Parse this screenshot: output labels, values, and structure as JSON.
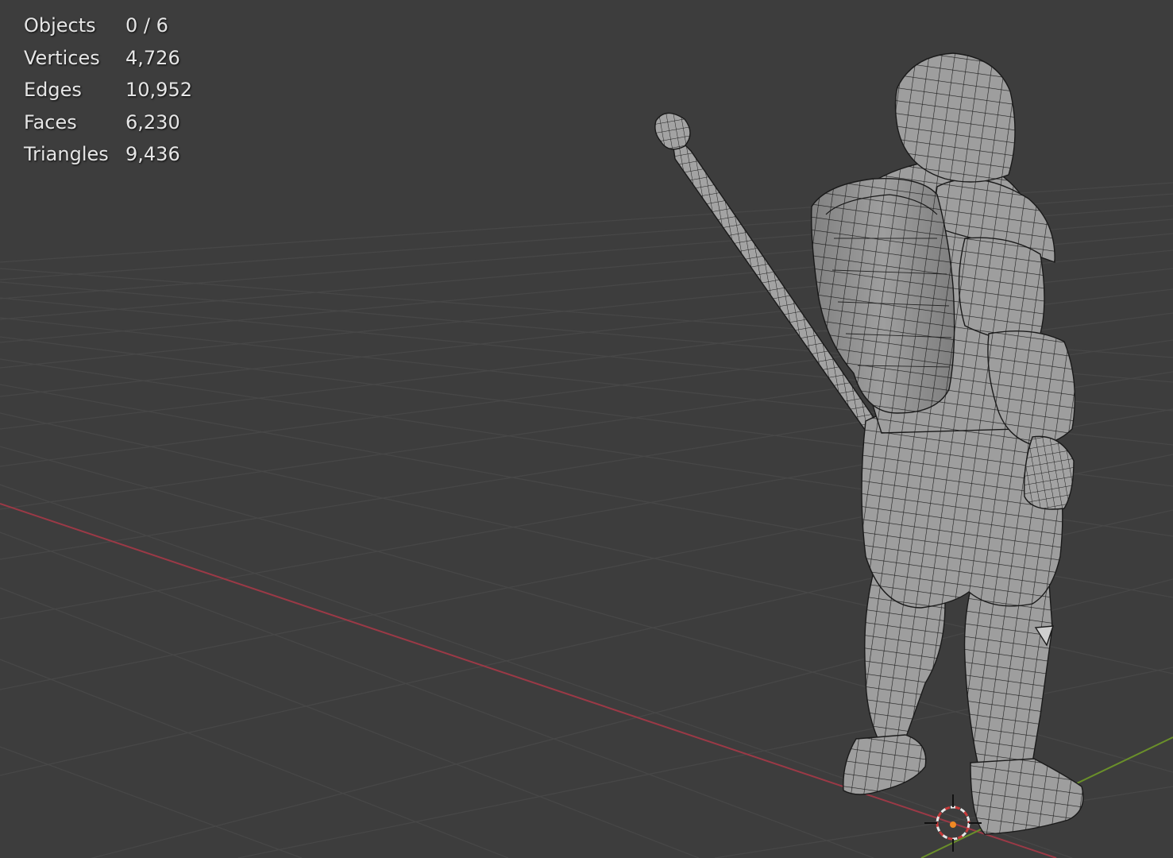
{
  "stats": {
    "rows": [
      {
        "label": "Objects",
        "value": "0 / 6"
      },
      {
        "label": "Vertices",
        "value": "4,726"
      },
      {
        "label": "Edges",
        "value": "10,952"
      },
      {
        "label": "Faces",
        "value": "6,230"
      },
      {
        "label": "Triangles",
        "value": "9,436"
      }
    ]
  },
  "colors": {
    "background": "#3d3d3d",
    "grid": "#474747",
    "x_axis": "#9b3946",
    "y_axis": "#6a8f2a",
    "mesh_fill": "#9a9a9a",
    "wire": "#1a1a1a",
    "origin": "#f08a24"
  }
}
